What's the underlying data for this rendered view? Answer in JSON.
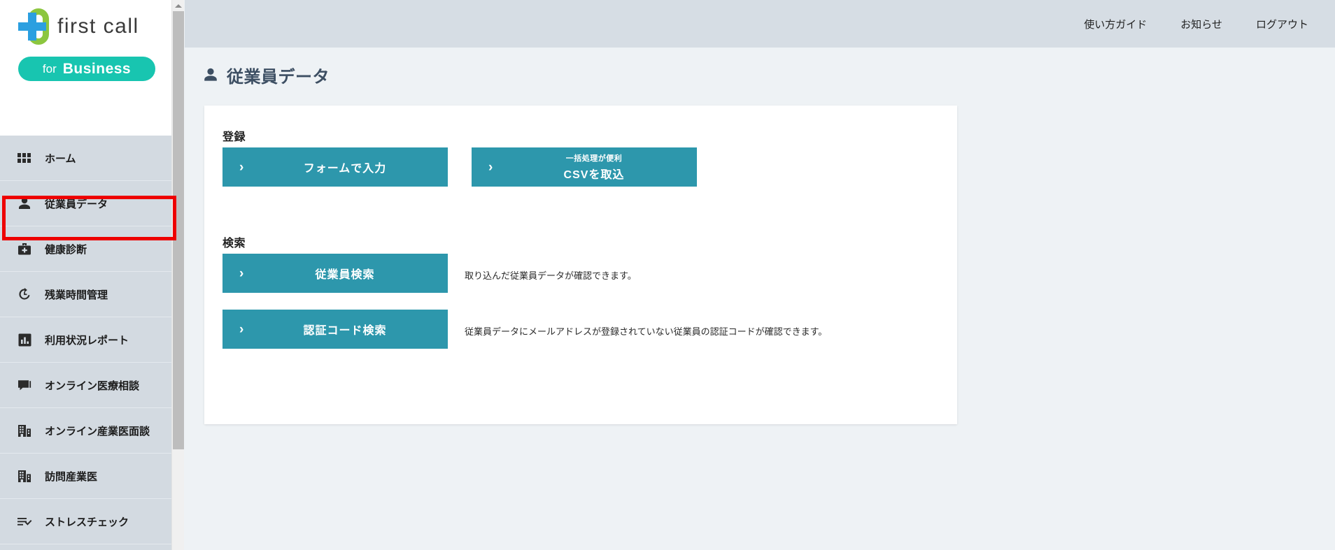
{
  "brand": {
    "logo_text": "first call",
    "badge_for": "for",
    "badge_business": "Business",
    "logo_icon": "firstcall-cross-logo"
  },
  "header": {
    "links": [
      {
        "label": "使い方ガイド",
        "name": "header-link-guide"
      },
      {
        "label": "お知らせ",
        "name": "header-link-notices"
      },
      {
        "label": "ログアウト",
        "name": "header-link-logout"
      }
    ]
  },
  "sidebar": {
    "items": [
      {
        "label": "ホーム",
        "icon": "grid-icon",
        "active": false
      },
      {
        "label": "従業員データ",
        "icon": "person-icon",
        "active": true
      },
      {
        "label": "健康診断",
        "icon": "medical-bag-icon",
        "active": false
      },
      {
        "label": "残業時間管理",
        "icon": "clock-rotate-icon",
        "active": false
      },
      {
        "label": "利用状況レポート",
        "icon": "bar-chart-icon",
        "active": false
      },
      {
        "label": "オンライン医療相談",
        "icon": "chat-bubble-icon",
        "active": false
      },
      {
        "label": "オンライン産業医面談",
        "icon": "building-icon",
        "active": false
      },
      {
        "label": "訪問産業医",
        "icon": "building-icon",
        "active": false
      },
      {
        "label": "ストレスチェック",
        "icon": "checklist-icon",
        "active": false
      }
    ],
    "scrollbar": {
      "up_arrow": "scroll-up-arrow"
    }
  },
  "page": {
    "title": "従業員データ",
    "title_icon": "person-icon"
  },
  "card": {
    "sections": [
      {
        "heading": "登録"
      },
      {
        "heading": "検索"
      }
    ],
    "buttons": {
      "form_input": {
        "label": "フォームで入力",
        "chevron": "›"
      },
      "csv_import": {
        "sub_label": "一括処理が便利",
        "label": "CSVを取込",
        "chevron": "›"
      },
      "employee_search": {
        "label": "従業員検索",
        "chevron": "›"
      },
      "auth_code_search": {
        "label": "認証コード検索",
        "chevron": "›"
      }
    },
    "descriptions": {
      "employee_search": "取り込んだ従業員データが確認できます。",
      "auth_code_search": "従業員データにメールアドレスが登録されていない従業員の認証コードが確認できます。"
    }
  },
  "annotation": {
    "highlight_target": "従業員データ",
    "color": "#ee0000"
  },
  "colors": {
    "teal_button": "#2d97ac",
    "sidebar_bg": "#d3dae1",
    "header_bg": "#d6dde4",
    "main_bg": "#eef2f5",
    "title_text": "#3d4f63",
    "badge_teal": "#18c5b0",
    "logo_green": "#8cc63f",
    "logo_blue": "#2b9fe0"
  }
}
